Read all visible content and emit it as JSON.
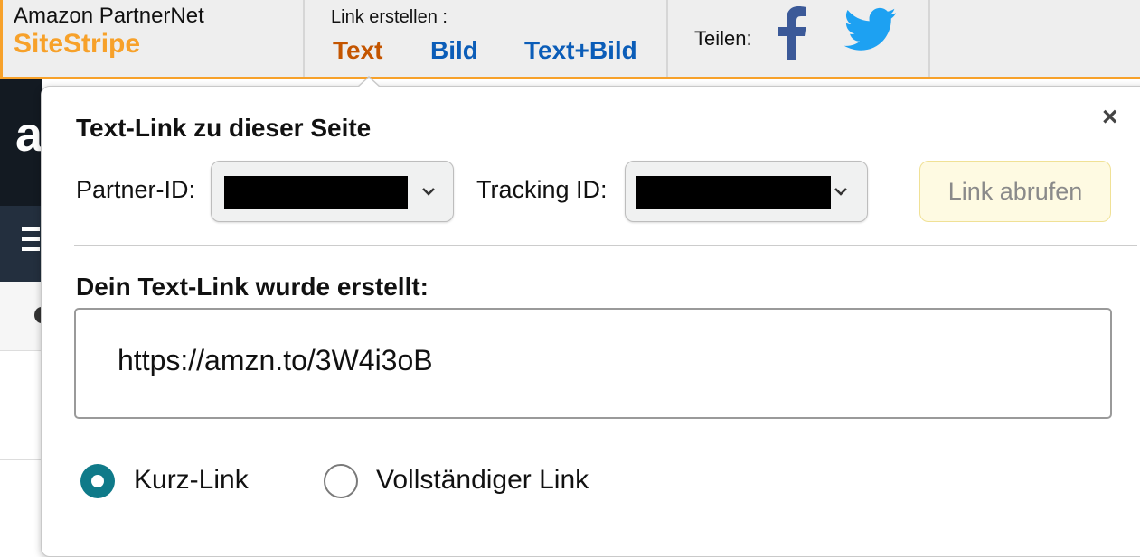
{
  "sitestripe": {
    "brand_sub": "Amazon PartnerNet",
    "brand_title": "SiteStripe",
    "create_label": "Link erstellen :",
    "tabs": [
      {
        "label": "Text",
        "active": true
      },
      {
        "label": "Bild",
        "active": false
      },
      {
        "label": "Text+Bild",
        "active": false
      }
    ],
    "share_label": "Teilen:",
    "share_icons": [
      "facebook-icon",
      "twitter-icon"
    ],
    "colors": {
      "accent": "#f7a12a",
      "active_tab": "#c45500",
      "link": "#0b5db8"
    }
  },
  "background_page": {
    "logo_letter": "a"
  },
  "popover": {
    "title": "Text-Link zu dieser Seite",
    "close_symbol": "×",
    "partner_id_label": "Partner-ID:",
    "partner_id_value": "[redacted]",
    "tracking_id_label": "Tracking ID:",
    "tracking_id_value": "[redacted]",
    "get_link_button": "Link abrufen",
    "result_heading": "Dein Text-Link wurde erstellt:",
    "link_url": "https://amzn.to/3W4i3oB",
    "link_type_options": [
      {
        "label": "Kurz-Link",
        "selected": true
      },
      {
        "label": "Vollständiger Link",
        "selected": false
      }
    ],
    "colors": {
      "radio_selected": "#0f7a89",
      "button_bg": "#fefae2"
    }
  }
}
